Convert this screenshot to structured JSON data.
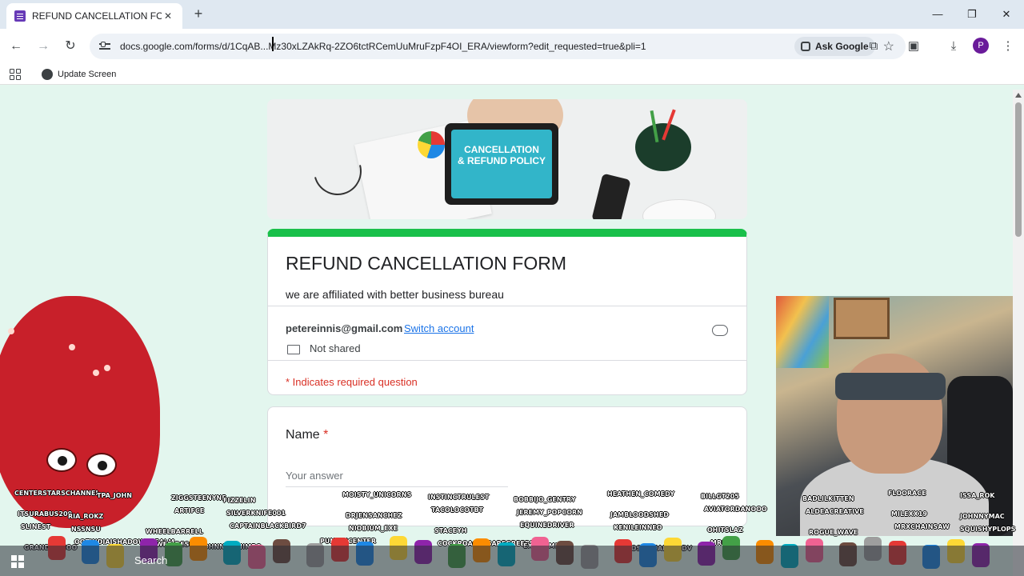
{
  "browser": {
    "tab": {
      "title": "REFUND CANCELLATION FORM",
      "close": "✕"
    },
    "new_tab": "+",
    "window_controls": {
      "minimize": "—",
      "restore": "❐",
      "close": "✕"
    },
    "nav": {
      "back": "←",
      "forward": "→",
      "reload": "↻"
    },
    "url": "docs.google.com/forms/d/1CqAB...Mz30xLZAkRq-2ZO6tctRCemUuMruFzpF4OI_ERA/viewform?edit_requested=true&pli=1",
    "ask_google": "Ask Google",
    "star": "☆",
    "profile_initial": "P",
    "update_screen": "Update Screen"
  },
  "banner": {
    "text_line1": "CANCELLATION",
    "text_line2": "& REFUND POLICY"
  },
  "form": {
    "title": "REFUND CANCELLATION FORM",
    "description": "we are affiliated with better business bureau",
    "email": "petereinnis@gmail.com",
    "switch_account": "Switch account",
    "not_shared": "Not shared",
    "required_note": "* Indicates required question",
    "question": {
      "label": "Name",
      "required_marker": "*",
      "placeholder": "Your answer"
    }
  },
  "stream": {
    "names": [
      "CENTERSTARSCHANNEL",
      "TPA_JOHN",
      "ZIGGSTEENYNE",
      "FIZZELIN",
      "MOISTY_UNICORNS",
      "INSTINCTRULEST",
      "BOBBIJO_GENTRY",
      "HEATHEN_COMEDY",
      "BILLGT205",
      "BADLILKITTEN",
      "FLOORACE",
      "ISSA_ROK",
      "ITSURABUS200",
      "RIA_ROKZ",
      "ARTIFCE",
      "SILVERKNIFE001",
      "DRJENSANCHEZ",
      "TACOLOCOTBT",
      "JEREMY_POPCORN",
      "JAMBLOODSHED",
      "AVIATORDANOOO",
      "ALDEACREATIVE",
      "MILEXX19",
      "JOHNNYMAC",
      "SLINEST",
      "NSSNSU",
      "WHEELBARRELL",
      "CAPTAINBLACKBIRD7",
      "NIOBIUM_EXE",
      "STACEYH",
      "EQUINEDRIVER",
      "KENILEINNEO",
      "OHITSLAZ",
      "ROGUE_WAVE",
      "MRXCHAINSAW",
      "SQUISHYPLOPS",
      "GRANDWAZOO",
      "OOTINDIAISHADOWSREALM",
      "CJWEB-DESIGN",
      "JOHNNY_CHIMPO",
      "PUNKINCENTER",
      "COCKROACHESAREGREEPS",
      "EXITERMINII",
      "MOJOSBIZZARREADV",
      "MRKIMI"
    ]
  },
  "taskbar": {
    "search": "Search"
  }
}
